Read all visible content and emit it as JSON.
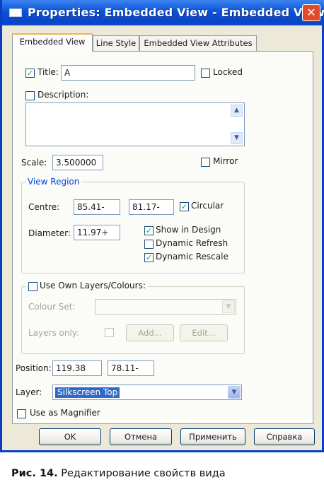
{
  "window": {
    "title": "Properties: Embedded View - Embedded View",
    "close_glyph": "✕"
  },
  "tabs": [
    {
      "label": "Embedded View"
    },
    {
      "label": "Line Style"
    },
    {
      "label": "Embedded View Attributes"
    }
  ],
  "title_field": {
    "label": "Title:",
    "value": "A",
    "checked": true
  },
  "locked": {
    "label": "Locked",
    "checked": false
  },
  "description": {
    "label": "Description:",
    "checked": false
  },
  "scale": {
    "label": "Scale:",
    "value": "3.500000"
  },
  "mirror": {
    "label": "Mirror",
    "checked": false
  },
  "view_region": {
    "legend": "View Region",
    "centre_label": "Centre:",
    "centre_x": "85.41-",
    "centre_y": "81.17-",
    "circular_label": "Circular",
    "diameter_label": "Diameter:",
    "diameter_value": "11.97+",
    "show_in_design": "Show in Design",
    "dynamic_refresh": "Dynamic Refresh",
    "dynamic_rescale": "Dynamic Rescale"
  },
  "own_layers": {
    "legend": "Use Own Layers/Colours:",
    "colour_set_label": "Colour Set:",
    "layers_only_label": "Layers only:",
    "add_button": "Add...",
    "edit_button": "Edit..."
  },
  "position": {
    "label": "Position:",
    "x": "119.38",
    "y": "78.11-"
  },
  "layer": {
    "label": "Layer:",
    "value": "Silkscreen Top"
  },
  "magnifier": {
    "label": "Use as Magnifier"
  },
  "buttons": {
    "ok": "OK",
    "cancel": "Отмена",
    "apply": "Применить",
    "help": "Справка"
  },
  "caption": {
    "prefix": "Рис. 14.",
    "text": "Редактирование свойств вида"
  },
  "check_glyph": "✓",
  "arrow_up": "▲",
  "arrow_down": "▼"
}
